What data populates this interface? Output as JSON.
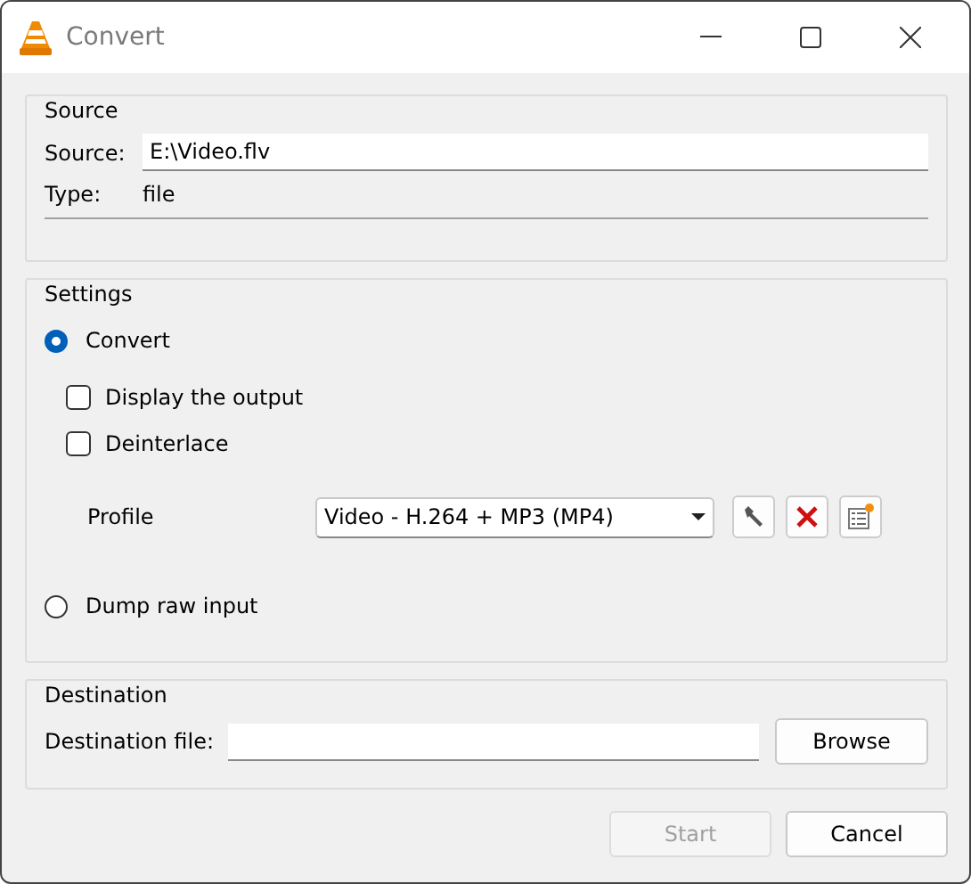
{
  "window": {
    "title": "Convert"
  },
  "source": {
    "title": "Source",
    "source_label": "Source:",
    "source_value": "E:\\Video.flv",
    "type_label": "Type:",
    "type_value": "file"
  },
  "settings": {
    "title": "Settings",
    "convert": {
      "label": "Convert",
      "selected": true
    },
    "options": [
      {
        "label": "Display the output",
        "checked": false
      },
      {
        "label": "Deinterlace",
        "checked": false
      }
    ],
    "profile_label": "Profile",
    "profile_value": "Video - H.264 + MP3 (MP4)",
    "dump": {
      "label": "Dump raw input",
      "selected": false
    }
  },
  "destination": {
    "title": "Destination",
    "file_label": "Destination file:",
    "browse": "Browse"
  },
  "buttons": [
    {
      "label": "Start",
      "disabled": true
    },
    {
      "label": "Cancel",
      "disabled": false
    }
  ]
}
